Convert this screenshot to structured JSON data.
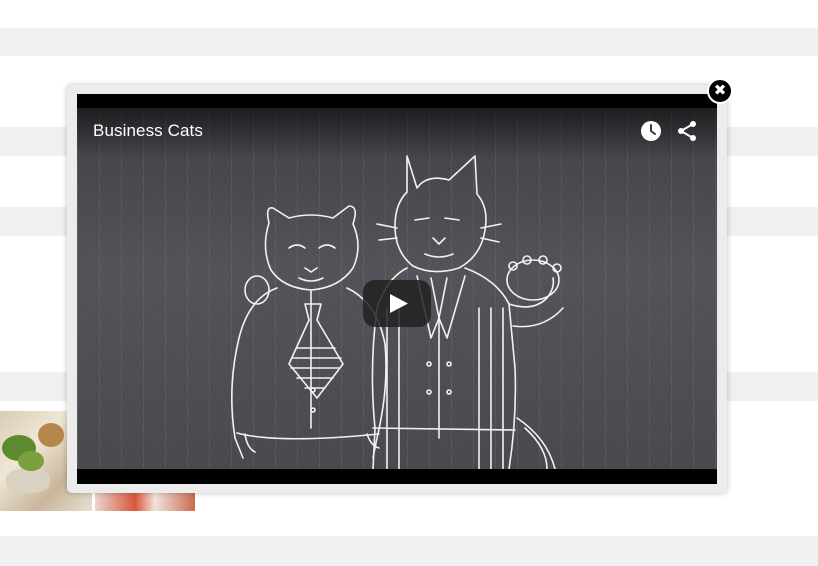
{
  "video": {
    "title": "Business Cats"
  },
  "icons": {
    "close": "close-icon",
    "watch_later": "clock-icon",
    "share": "share-icon",
    "play": "play-icon"
  },
  "colors": {
    "overlay_bg": "#ececec",
    "player_bg": "#000000",
    "stripe": "#f0f0f0"
  }
}
